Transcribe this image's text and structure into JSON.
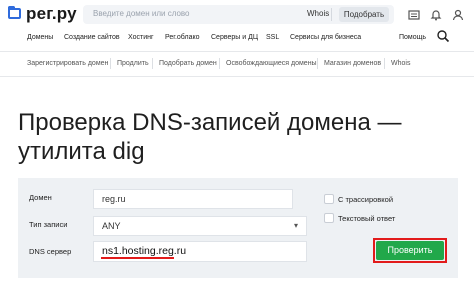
{
  "header": {
    "logo": "рег.ру",
    "search_placeholder": "Введите домен или слово",
    "whois": "Whois",
    "pick": "Подобрать"
  },
  "icons": [
    "cart-icon",
    "bell-icon",
    "user-icon"
  ],
  "nav": {
    "items": [
      "Домены",
      "Создание сайтов",
      "Хостинг",
      "Рег.облако",
      "Серверы и ДЦ",
      "SSL",
      "Сервисы для бизнеса"
    ],
    "help": "Помощь"
  },
  "subnav": {
    "items": [
      "Зарегистрировать домен",
      "Продлить",
      "Подобрать домен",
      "Освобождающиеся домены",
      "Магазин доменов",
      "Whois"
    ]
  },
  "page": {
    "title": "Проверка DNS-записей домена — утилита dig"
  },
  "form": {
    "domain_label": "Домен",
    "domain_value": "reg.ru",
    "type_label": "Тип записи",
    "type_value": "ANY",
    "dns_label": "DNS сервер",
    "dns_value": "ns1.hosting.reg.ru",
    "trace_label": "С трассировкой",
    "text_label": "Текстовый ответ",
    "submit": "Проверить"
  },
  "colors": {
    "brand": "#2f6bdc",
    "accent_green": "#21a84a",
    "highlight_red": "#e21b1b"
  }
}
